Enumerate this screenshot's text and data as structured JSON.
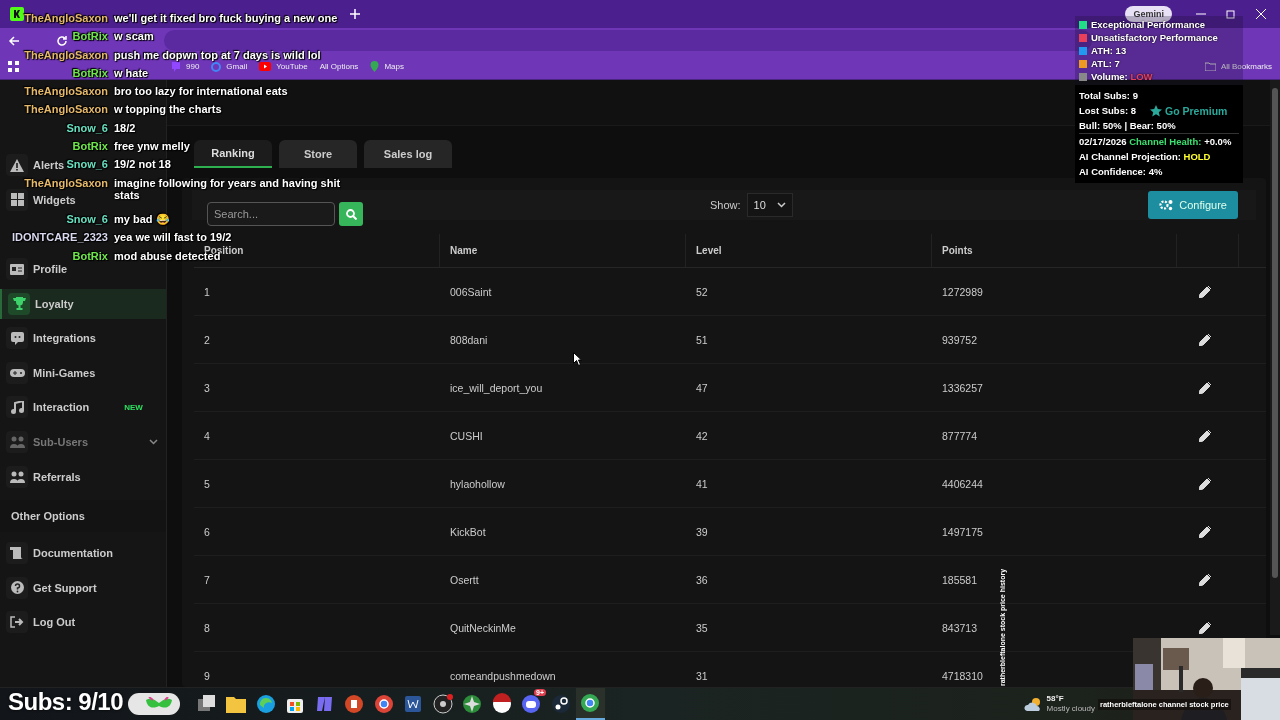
{
  "browser": {
    "gemini": "Gemini",
    "bookmarks": [
      "990",
      "Gmail",
      "YouTube",
      "All Options",
      "Maps"
    ],
    "all_bookmarks": "All Bookmarks"
  },
  "sidebar": {
    "items": [
      {
        "label": "Alerts",
        "selected": false,
        "disabled": false
      },
      {
        "label": "Widgets",
        "selected": false,
        "disabled": false
      },
      {
        "label": "Profile",
        "selected": false,
        "disabled": false
      },
      {
        "label": "Loyalty",
        "selected": true,
        "disabled": false
      },
      {
        "label": "Integrations",
        "selected": false,
        "disabled": false
      },
      {
        "label": "Mini-Games",
        "selected": false,
        "disabled": false
      },
      {
        "label": "Interaction",
        "selected": false,
        "disabled": false,
        "badge": "NEW"
      },
      {
        "label": "Sub-Users",
        "selected": false,
        "disabled": true
      },
      {
        "label": "Referrals",
        "selected": false,
        "disabled": false
      }
    ],
    "section": "Other Options",
    "other_items": [
      {
        "label": "Documentation"
      },
      {
        "label": "Get Support"
      },
      {
        "label": "Log Out"
      }
    ]
  },
  "tabs": [
    {
      "label": "Ranking",
      "selected": true
    },
    {
      "label": "Store",
      "selected": false
    },
    {
      "label": "Sales log",
      "selected": false
    }
  ],
  "toolbar": {
    "search": {
      "placeholder": "Search..."
    },
    "show_label": "Show:",
    "show_value": "10",
    "configure": "Configure"
  },
  "table": {
    "columns": [
      "Position",
      "Name",
      "Level",
      "Points"
    ],
    "rows": [
      [
        "1",
        "006Saint",
        "52",
        "1272989"
      ],
      [
        "2",
        "808dani",
        "51",
        "939752"
      ],
      [
        "3",
        "ice_will_deport_you",
        "47",
        "1336257"
      ],
      [
        "4",
        "CUSHI",
        "42",
        "877774"
      ],
      [
        "5",
        "hylaohollow",
        "41",
        "4406244"
      ],
      [
        "6",
        "KickBot",
        "39",
        "1497175"
      ],
      [
        "7",
        "Osertt",
        "36",
        "185581"
      ],
      [
        "8",
        "QuitNeckinMe",
        "35",
        "843713"
      ],
      [
        "9",
        "comeandpushmedown",
        "31",
        "4718310"
      ]
    ]
  },
  "chat": [
    {
      "user": "TheAngloSaxon",
      "color": "#e6b96a",
      "text": "we'll get it fixed bro fuck buying a new one"
    },
    {
      "user": "BotRix",
      "color": "#6ee84a",
      "text": "w scam"
    },
    {
      "user": "TheAngloSaxon",
      "color": "#e6b96a",
      "text": "push me dopwn top at 7 days is wild lol"
    },
    {
      "user": "BotRix",
      "color": "#6ee84a",
      "text": "w hate"
    },
    {
      "user": "TheAngloSaxon",
      "color": "#e6b96a",
      "text": "bro too lazy for international eats"
    },
    {
      "user": "TheAngloSaxon",
      "color": "#e6b96a",
      "text": "w topping the charts"
    },
    {
      "user": "Snow_6",
      "color": "#68e0c0",
      "text": "18/2"
    },
    {
      "user": "BotRix",
      "color": "#6ee84a",
      "text": "free ynw melly"
    },
    {
      "user": "Snow_6",
      "color": "#68e0c0",
      "text": "19/2 not 18"
    },
    {
      "user": "TheAngloSaxon",
      "color": "#e6b96a",
      "text": "imagine following for years and having shit stats"
    },
    {
      "user": "Snow_6",
      "color": "#68e0c0",
      "text": "my bad 😂"
    },
    {
      "user": "IDONTCARE_2323",
      "color": "#d8d8ee",
      "text": "yea we will fast to 19/2"
    },
    {
      "user": "BotRix",
      "color": "#6ee84a",
      "text": "mod abuse detected"
    }
  ],
  "stats": {
    "legend": [
      {
        "color": "#22dd88",
        "parts": [
          {
            "text": "Exceptional Performance",
            "kind": "plain"
          }
        ]
      },
      {
        "color": "#e8405a",
        "parts": [
          {
            "text": "Unsatisfactory Performance",
            "kind": "plain"
          }
        ]
      },
      {
        "color": "#2299ee",
        "parts": [
          {
            "text": "ATH: 13",
            "kind": "plain"
          }
        ]
      },
      {
        "color": "#ee9922",
        "parts": [
          {
            "text": "ATL: 7",
            "kind": "plain"
          }
        ]
      },
      {
        "color": "#888888",
        "parts": [
          {
            "text": "Volume: ",
            "kind": "plain"
          },
          {
            "text": "LOW",
            "kind": "red"
          }
        ]
      }
    ],
    "lines": [
      [
        {
          "text": "Total Subs: 9",
          "kind": "plain"
        }
      ],
      [
        {
          "text": "Lost Subs: 8",
          "kind": "plain"
        },
        {
          "text": "Go Premium",
          "kind": "premium"
        }
      ],
      [
        {
          "text": "Bull: 50% | Bear: 50%",
          "kind": "plain"
        }
      ],
      [
        {
          "text": "02/17/2026 ",
          "kind": "plain"
        },
        {
          "text": "Channel Health:",
          "kind": "green"
        },
        {
          "text": " +0.0%",
          "kind": "plain"
        }
      ],
      [
        {
          "text": "AI Channel Projection: ",
          "kind": "plain"
        },
        {
          "text": "HOLD",
          "kind": "yellow"
        }
      ],
      [
        {
          "text": "AI Confidence: 4%",
          "kind": "plain"
        }
      ]
    ]
  },
  "stream": {
    "subs": "Subs: 9/10",
    "vertical_caption": "ratherbleftalone stock price history",
    "caption": "ratherbleftalone channel stock price"
  },
  "taskbar": {
    "badge": "9+",
    "weather": {
      "temp": "58°F",
      "condition": "Mostly cloudy"
    }
  }
}
